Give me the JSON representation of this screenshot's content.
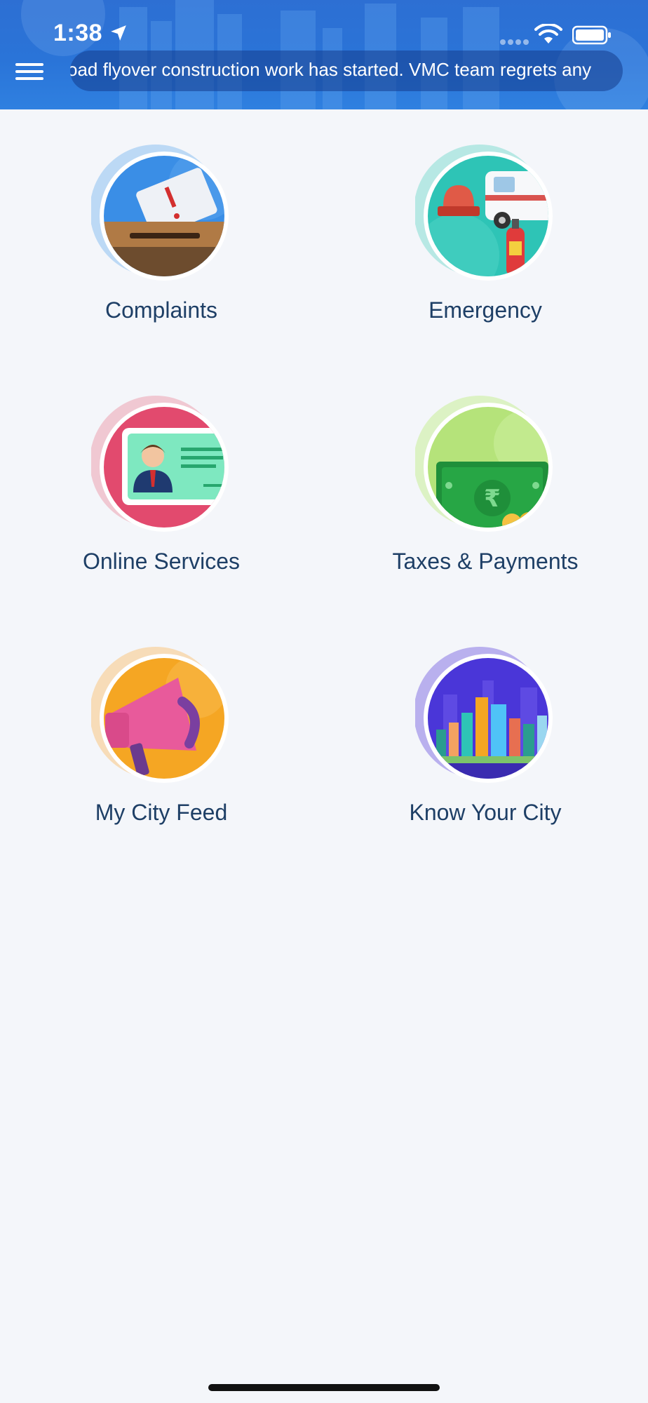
{
  "status_bar": {
    "time": "1:38",
    "icons": [
      "location-arrow-icon",
      "signal-icon",
      "wifi-icon",
      "battery-icon"
    ]
  },
  "header": {
    "menu_icon": "hamburger-menu-icon",
    "ticker_text": "oad flyover construction work has started. VMC team regrets any"
  },
  "tiles": [
    {
      "label": "Complaints",
      "icon": "complaint-box-icon",
      "color": "#3a8ee6"
    },
    {
      "label": "Emergency",
      "icon": "ambulance-icon",
      "color": "#2ec4b6"
    },
    {
      "label": "Online Services",
      "icon": "id-card-icon",
      "color": "#e24a6e"
    },
    {
      "label": "Taxes & Payments",
      "icon": "rupee-note-icon",
      "color": "#b5e37a"
    },
    {
      "label": "My City Feed",
      "icon": "megaphone-icon",
      "color": "#f5a623"
    },
    {
      "label": "Know Your City",
      "icon": "city-skyline-icon",
      "color": "#4a36d8"
    }
  ]
}
